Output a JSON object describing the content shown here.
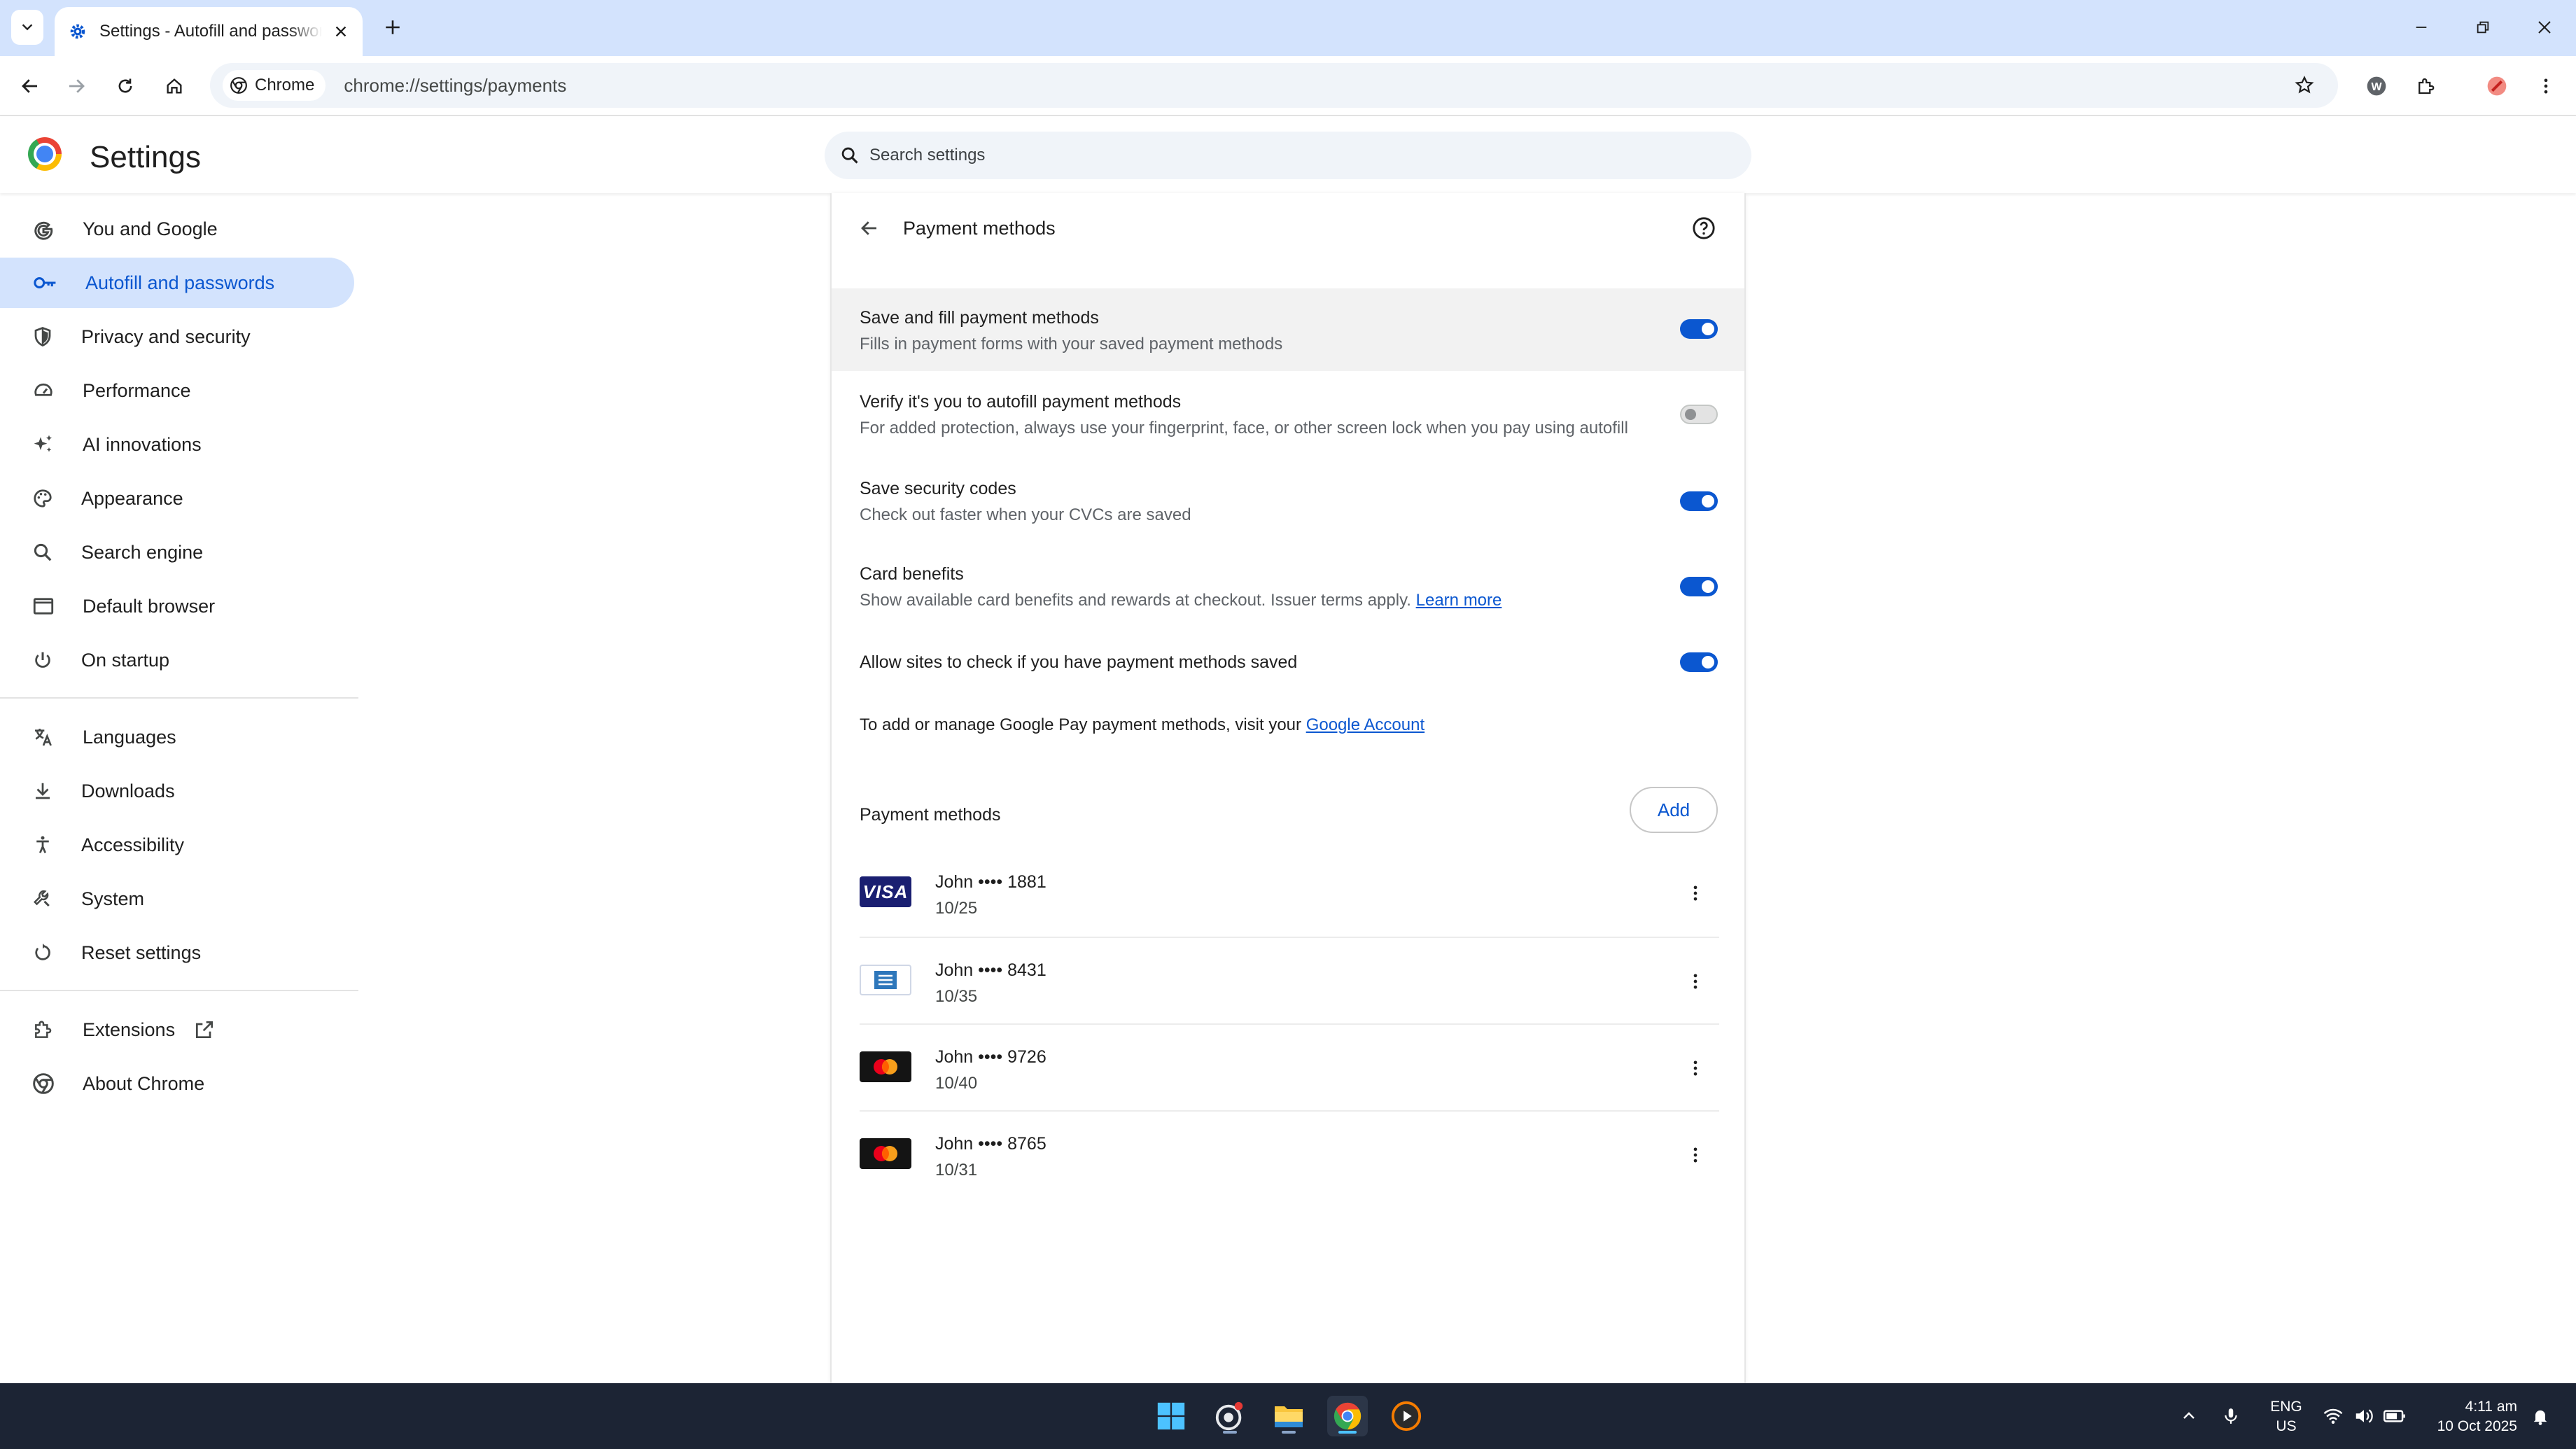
{
  "browser": {
    "tab_title": "Settings - Autofill and passwords",
    "chip_label": "Chrome",
    "url": "chrome://settings/payments"
  },
  "settings": {
    "title": "Settings",
    "search_placeholder": "Search settings"
  },
  "sidebar": {
    "items": [
      {
        "label": "You and Google",
        "icon": "google-g-icon"
      },
      {
        "label": "Autofill and passwords",
        "icon": "key-icon",
        "active": true
      },
      {
        "label": "Privacy and security",
        "icon": "shield-icon"
      },
      {
        "label": "Performance",
        "icon": "speedometer-icon"
      },
      {
        "label": "AI innovations",
        "icon": "sparkle-icon"
      },
      {
        "label": "Appearance",
        "icon": "palette-icon"
      },
      {
        "label": "Search engine",
        "icon": "search-icon"
      },
      {
        "label": "Default browser",
        "icon": "browser-window-icon"
      },
      {
        "label": "On startup",
        "icon": "power-icon"
      },
      {
        "label": "Languages",
        "icon": "translate-icon"
      },
      {
        "label": "Downloads",
        "icon": "download-icon"
      },
      {
        "label": "Accessibility",
        "icon": "accessibility-icon"
      },
      {
        "label": "System",
        "icon": "wrench-icon"
      },
      {
        "label": "Reset settings",
        "icon": "reset-icon"
      },
      {
        "label": "Extensions",
        "icon": "puzzle-icon"
      },
      {
        "label": "About Chrome",
        "icon": "chrome-icon"
      }
    ]
  },
  "payments": {
    "page_title": "Payment methods",
    "settings": [
      {
        "title": "Save and fill payment methods",
        "subtitle": "Fills in payment forms with your saved payment methods",
        "enabled": true
      },
      {
        "title": "Verify it's you to autofill payment methods",
        "subtitle": "For added protection, always use your fingerprint, face, or other screen lock when you pay using autofill",
        "enabled": false
      },
      {
        "title": "Save security codes",
        "subtitle": "Check out faster when your CVCs are saved",
        "enabled": true
      },
      {
        "title": "Card benefits",
        "subtitle": "Show available card benefits and rewards at checkout. Issuer terms apply.",
        "link": "Learn more",
        "enabled": true
      },
      {
        "title": "Allow sites to check if you have payment methods saved",
        "enabled": true
      }
    ],
    "gpay_text": "To add or manage Google Pay payment methods, visit your",
    "gpay_link": "Google Account",
    "list_heading": "Payment methods",
    "add_label": "Add",
    "cards": [
      {
        "brand": "visa",
        "brand_text": "VISA",
        "line1": "John •••• 1881",
        "expiry": "10/25"
      },
      {
        "brand": "amex",
        "line1": "John •••• 8431",
        "expiry": "10/35"
      },
      {
        "brand": "mastercard",
        "line1": "John •••• 9726",
        "expiry": "10/40"
      },
      {
        "brand": "mastercard",
        "line1": "John •••• 8765",
        "expiry": "10/31"
      }
    ]
  },
  "taskbar": {
    "lang_line1": "ENG",
    "lang_line2": "US",
    "time": "4:11 am",
    "date": "10 Oct 2025"
  },
  "colors": {
    "accent": "#0b57d0",
    "tabstrip": "#d3e3fd",
    "taskbar": "#1c2434"
  }
}
